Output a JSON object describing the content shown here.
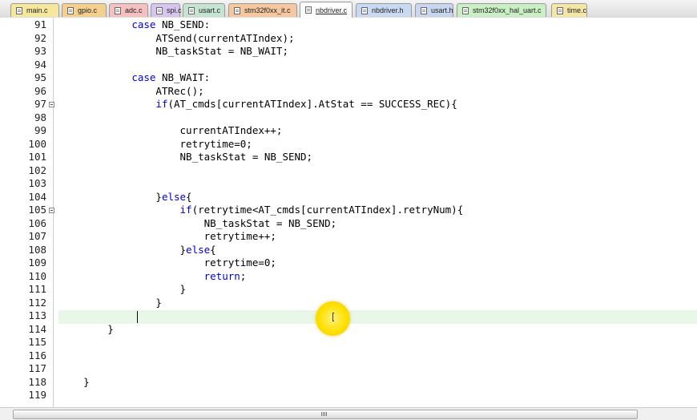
{
  "tabs": [
    {
      "label": "main.c",
      "color": "#f5e79b"
    },
    {
      "label": "gpio.c",
      "color": "#f4d08f"
    },
    {
      "label": "adc.c",
      "color": "#f6c0c0"
    },
    {
      "label": "spi.c",
      "color": "#d6c5ef"
    },
    {
      "label": "usart.c",
      "color": "#c5e4d2"
    },
    {
      "label": "stm32f0xx_it.c",
      "color": "#f6c8a0"
    },
    {
      "label": "nbdriver.c",
      "color": "#ffffff",
      "active": true
    },
    {
      "label": "nbdriver.h",
      "color": "#c9d9f2"
    },
    {
      "label": "usart.h",
      "color": "#c8d7ef"
    },
    {
      "label": "stm32f0xx_hal_uart.c",
      "color": "#cbefc4"
    },
    {
      "label": "time.c",
      "color": "#f4e6a6"
    }
  ],
  "editor": {
    "current_line": "113",
    "lines": [
      {
        "n": "91",
        "code": "            case NB_SEND:"
      },
      {
        "n": "92",
        "code": "                ATSend(currentATIndex);"
      },
      {
        "n": "93",
        "code": "                NB_taskStat = NB_WAIT;"
      },
      {
        "n": "94",
        "code": ""
      },
      {
        "n": "95",
        "code": "            case NB_WAIT:"
      },
      {
        "n": "96",
        "code": "                ATRec();"
      },
      {
        "n": "97",
        "code": "                if(AT_cmds[currentATIndex].AtStat == SUCCESS_REC){",
        "fold": true
      },
      {
        "n": "98",
        "code": ""
      },
      {
        "n": "99",
        "code": "                    currentATIndex++;"
      },
      {
        "n": "100",
        "code": "                    retrytime=0;"
      },
      {
        "n": "101",
        "code": "                    NB_taskStat = NB_SEND;"
      },
      {
        "n": "102",
        "code": ""
      },
      {
        "n": "103",
        "code": ""
      },
      {
        "n": "104",
        "code": "                }else{"
      },
      {
        "n": "105",
        "code": "                    if(retrytime<AT_cmds[currentATIndex].retryNum){",
        "fold": true
      },
      {
        "n": "106",
        "code": "                        NB_taskStat = NB_SEND;"
      },
      {
        "n": "107",
        "code": "                        retrytime++;"
      },
      {
        "n": "108",
        "code": "                    }else{"
      },
      {
        "n": "109",
        "code": "                        retrytime=0;"
      },
      {
        "n": "110",
        "code": "                        return;"
      },
      {
        "n": "111",
        "code": "                    }"
      },
      {
        "n": "112",
        "code": "                }"
      },
      {
        "n": "113",
        "code": ""
      },
      {
        "n": "114",
        "code": "        }"
      },
      {
        "n": "115",
        "code": ""
      },
      {
        "n": "116",
        "code": ""
      },
      {
        "n": "117",
        "code": ""
      },
      {
        "n": "118",
        "code": "    }"
      },
      {
        "n": "119",
        "code": ""
      }
    ],
    "keywords": [
      "case",
      "if",
      "else",
      "return"
    ],
    "keyword_color": "#0000d0",
    "current_line_color": "#e8f7e8"
  }
}
